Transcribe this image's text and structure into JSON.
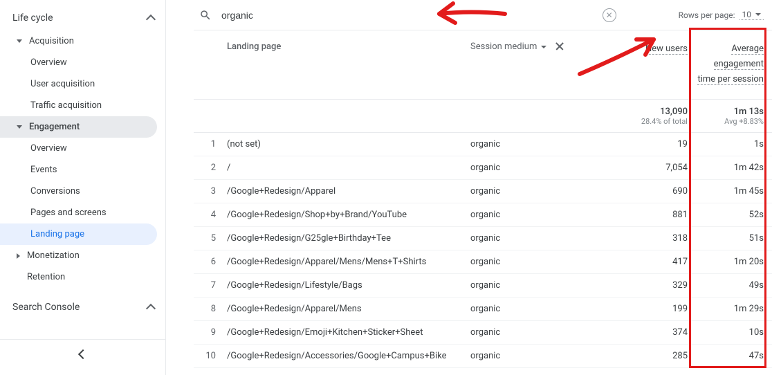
{
  "sidebar": {
    "sections": [
      {
        "label": "Life cycle",
        "expanded": true
      },
      {
        "label": "Search Console",
        "expanded": true
      }
    ],
    "items": {
      "acquisition": "Acquisition",
      "acq_overview": "Overview",
      "acq_user": "User acquisition",
      "acq_traffic": "Traffic acquisition",
      "engagement": "Engagement",
      "eng_overview": "Overview",
      "eng_events": "Events",
      "eng_conversions": "Conversions",
      "eng_pages": "Pages and screens",
      "eng_landing": "Landing page",
      "monetization": "Monetization",
      "retention": "Retention"
    }
  },
  "search": {
    "value": "organic",
    "rows_label": "Rows per page:",
    "rows_value": "10"
  },
  "headers": {
    "landing_page": "Landing page",
    "session_medium": "Session medium",
    "new_users": "New users",
    "avg_engagement": "Average engagement time per session"
  },
  "totals": {
    "new_users": "13,090",
    "new_users_sub": "28.4% of total",
    "avg_eng": "1m 13s",
    "avg_eng_sub": "Avg +8.83%"
  },
  "rows": [
    {
      "n": "1",
      "lp": "(not set)",
      "sm": "organic",
      "nu": "19",
      "ae": "1s"
    },
    {
      "n": "2",
      "lp": "/",
      "sm": "organic",
      "nu": "7,054",
      "ae": "1m 42s"
    },
    {
      "n": "3",
      "lp": "/Google+Redesign/Apparel",
      "sm": "organic",
      "nu": "690",
      "ae": "1m 45s"
    },
    {
      "n": "4",
      "lp": "/Google+Redesign/Shop+by+Brand/YouTube",
      "sm": "organic",
      "nu": "881",
      "ae": "52s"
    },
    {
      "n": "5",
      "lp": "/Google+Redesign/G25gle+Birthday+Tee",
      "sm": "organic",
      "nu": "318",
      "ae": "51s"
    },
    {
      "n": "6",
      "lp": "/Google+Redesign/Apparel/Mens/Mens+T+Shirts",
      "sm": "organic",
      "nu": "417",
      "ae": "1m 20s"
    },
    {
      "n": "7",
      "lp": "/Google+Redesign/Lifestyle/Bags",
      "sm": "organic",
      "nu": "329",
      "ae": "49s"
    },
    {
      "n": "8",
      "lp": "/Google+Redesign/Apparel/Mens",
      "sm": "organic",
      "nu": "199",
      "ae": "1m 29s"
    },
    {
      "n": "9",
      "lp": "/Google+Redesign/Emoji+Kitchen+Sticker+Sheet",
      "sm": "organic",
      "nu": "374",
      "ae": "10s"
    },
    {
      "n": "10",
      "lp": "/Google+Redesign/Accessories/Google+Campus+Bike",
      "sm": "organic",
      "nu": "285",
      "ae": "47s"
    }
  ]
}
